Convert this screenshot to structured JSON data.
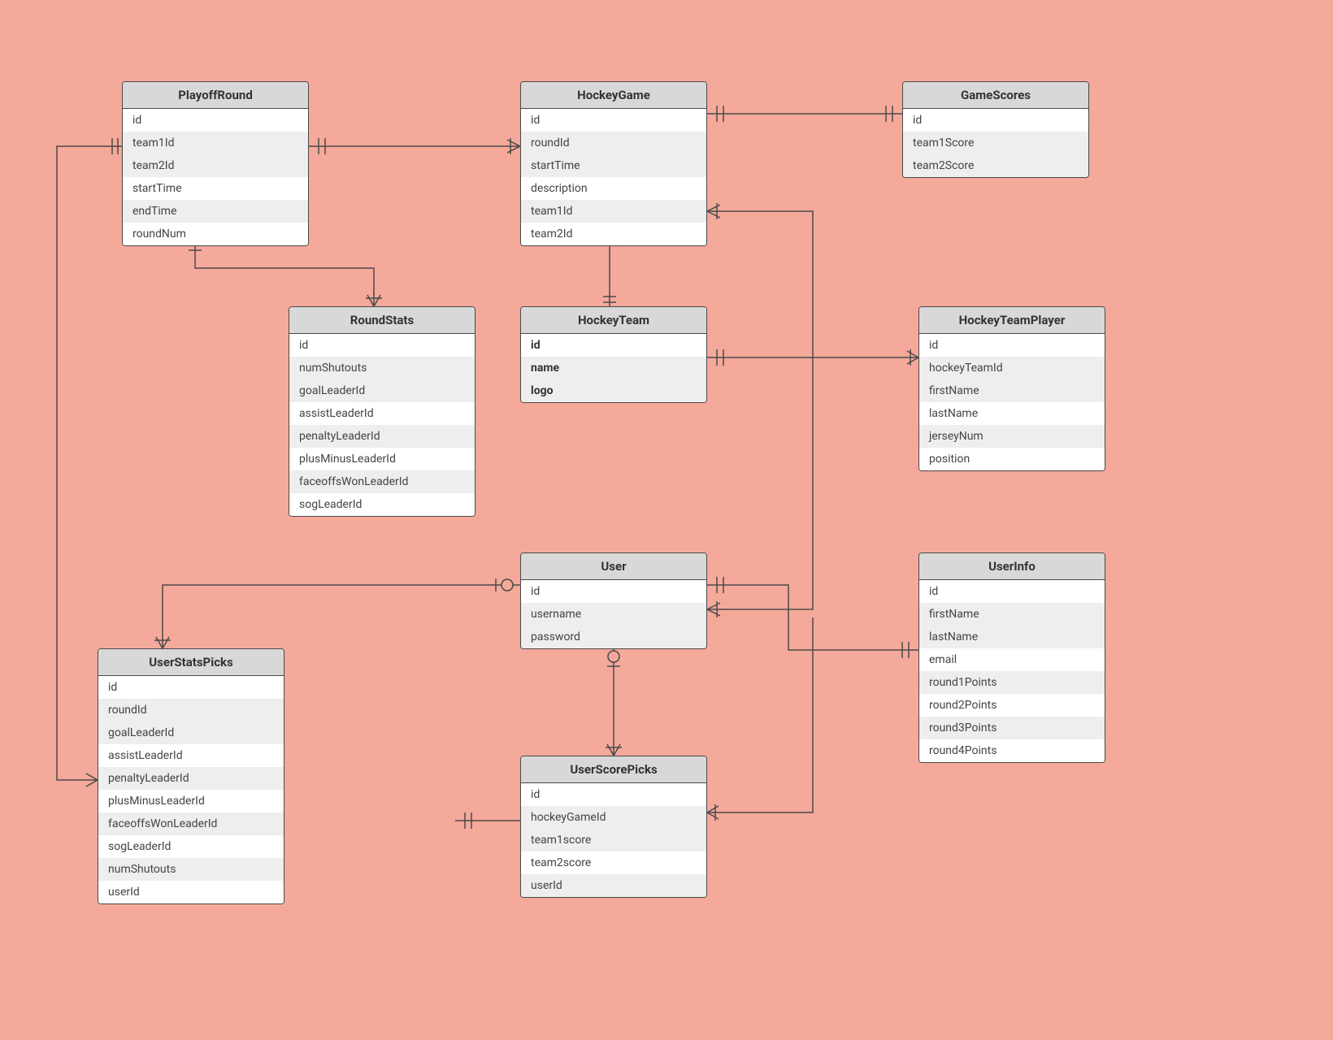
{
  "entities": {
    "playoffRound": {
      "title": "PlayoffRound",
      "attrs": [
        "id",
        "team1Id",
        "team2Id",
        "startTime",
        "endTime",
        "roundNum"
      ]
    },
    "hockeyGame": {
      "title": "HockeyGame",
      "attrs": [
        "id",
        "roundId",
        "startTime",
        "description",
        "team1Id",
        "team2Id"
      ]
    },
    "gameScores": {
      "title": "GameScores",
      "attrs": [
        "id",
        "team1Score",
        "team2Score"
      ]
    },
    "roundStats": {
      "title": "RoundStats",
      "attrs": [
        "id",
        "numShutouts",
        "goalLeaderId",
        "assistLeaderId",
        "penaltyLeaderId",
        "plusMinusLeaderId",
        "faceoffsWonLeaderId",
        "sogLeaderId"
      ]
    },
    "hockeyTeam": {
      "title": "HockeyTeam",
      "attrs": [
        "id",
        "name",
        "logo"
      ],
      "bold": true
    },
    "hockeyTeamPlayer": {
      "title": "HockeyTeamPlayer",
      "attrs": [
        "id",
        "hockeyTeamId",
        "firstName",
        "lastName",
        "jerseyNum",
        "position"
      ]
    },
    "user": {
      "title": "User",
      "attrs": [
        "id",
        "username",
        "password"
      ]
    },
    "userInfo": {
      "title": "UserInfo",
      "attrs": [
        "id",
        "firstName",
        "lastName",
        "email",
        "round1Points",
        "round2Points",
        "round3Points",
        "round4Points"
      ]
    },
    "userStatsPicks": {
      "title": "UserStatsPicks",
      "attrs": [
        "id",
        "roundId",
        "goalLeaderId",
        "assistLeaderId",
        "penaltyLeaderId",
        "plusMinusLeaderId",
        "faceoffsWonLeaderId",
        "sogLeaderId",
        "numShutouts",
        "userId"
      ]
    },
    "userScorePicks": {
      "title": "UserScorePicks",
      "attrs": [
        "id",
        "hockeyGameId",
        "team1score",
        "team2score",
        "userId"
      ]
    }
  },
  "chart_data": {
    "type": "er-diagram",
    "entities": [
      {
        "name": "PlayoffRound",
        "attributes": [
          "id",
          "team1Id",
          "team2Id",
          "startTime",
          "endTime",
          "roundNum"
        ]
      },
      {
        "name": "HockeyGame",
        "attributes": [
          "id",
          "roundId",
          "startTime",
          "description",
          "team1Id",
          "team2Id"
        ]
      },
      {
        "name": "GameScores",
        "attributes": [
          "id",
          "team1Score",
          "team2Score"
        ]
      },
      {
        "name": "RoundStats",
        "attributes": [
          "id",
          "numShutouts",
          "goalLeaderId",
          "assistLeaderId",
          "penaltyLeaderId",
          "plusMinusLeaderId",
          "faceoffsWonLeaderId",
          "sogLeaderId"
        ]
      },
      {
        "name": "HockeyTeam",
        "attributes": [
          "id",
          "name",
          "logo"
        ]
      },
      {
        "name": "HockeyTeamPlayer",
        "attributes": [
          "id",
          "hockeyTeamId",
          "firstName",
          "lastName",
          "jerseyNum",
          "position"
        ]
      },
      {
        "name": "User",
        "attributes": [
          "id",
          "username",
          "password"
        ]
      },
      {
        "name": "UserInfo",
        "attributes": [
          "id",
          "firstName",
          "lastName",
          "email",
          "round1Points",
          "round2Points",
          "round3Points",
          "round4Points"
        ]
      },
      {
        "name": "UserStatsPicks",
        "attributes": [
          "id",
          "roundId",
          "goalLeaderId",
          "assistLeaderId",
          "penaltyLeaderId",
          "plusMinusLeaderId",
          "faceoffsWonLeaderId",
          "sogLeaderId",
          "numShutouts",
          "userId"
        ]
      },
      {
        "name": "UserScorePicks",
        "attributes": [
          "id",
          "hockeyGameId",
          "team1score",
          "team2score",
          "userId"
        ]
      }
    ],
    "relationships": [
      {
        "from": "PlayoffRound",
        "to": "HockeyGame",
        "fromCard": "one",
        "toCard": "many"
      },
      {
        "from": "HockeyGame",
        "to": "GameScores",
        "fromCard": "one",
        "toCard": "one"
      },
      {
        "from": "PlayoffRound",
        "to": "RoundStats",
        "fromCard": "one",
        "toCard": "many"
      },
      {
        "from": "HockeyGame",
        "to": "HockeyTeam",
        "fromCard": "many",
        "toCard": "one"
      },
      {
        "from": "HockeyTeam",
        "to": "HockeyTeamPlayer",
        "fromCard": "one",
        "toCard": "many"
      },
      {
        "from": "User",
        "to": "UserStatsPicks",
        "fromCard": "zero-or-one",
        "toCard": "many"
      },
      {
        "from": "User",
        "to": "UserScorePicks",
        "fromCard": "zero-or-one",
        "toCard": "many"
      },
      {
        "from": "User",
        "to": "UserInfo",
        "fromCard": "one",
        "toCard": "one"
      },
      {
        "from": "User",
        "to": "HockeyGame",
        "fromCard": "many-optional",
        "toCard": "many"
      },
      {
        "from": "UserStatsPicks",
        "to": "PlayoffRound",
        "fromCard": "many",
        "toCard": "one"
      },
      {
        "from": "UserScorePicks",
        "to": "HockeyGame",
        "fromCard": "many",
        "toCard": "one"
      }
    ]
  }
}
